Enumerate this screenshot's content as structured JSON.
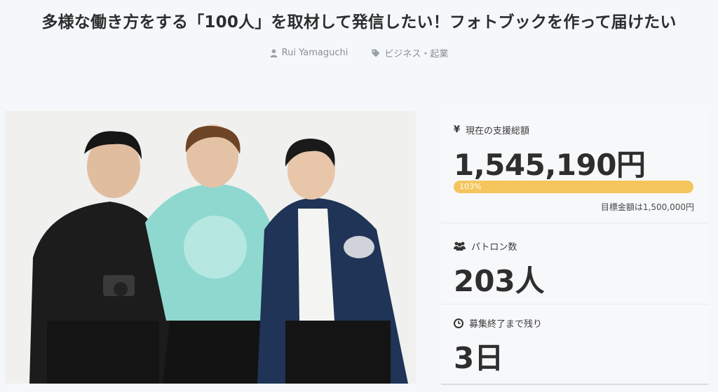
{
  "project": {
    "title": "多様な働き方をする「100人」を取材して発信したい！フォトブックを作って届けたい",
    "author": "Rui Yamaguchi",
    "category": "ビジネス・起業"
  },
  "funding": {
    "label": "現在の支援総額",
    "currency_icon": "¥",
    "amount": "1,545,190円",
    "progress_label": "103%",
    "progress_fraction": 1.0,
    "goal_text": "目標金額は1,500,000円"
  },
  "patrons": {
    "label": "パトロン数",
    "count": "203人"
  },
  "deadline": {
    "label": "募集終了まで残り",
    "remaining": "3日"
  },
  "icons": {
    "author": "user-icon",
    "category": "tag-icon",
    "patrons": "users-icon",
    "deadline": "clock-icon"
  },
  "colors": {
    "progress": "#f5c55d",
    "background": "#f5f8fb",
    "panel": "#f7f8fa"
  }
}
